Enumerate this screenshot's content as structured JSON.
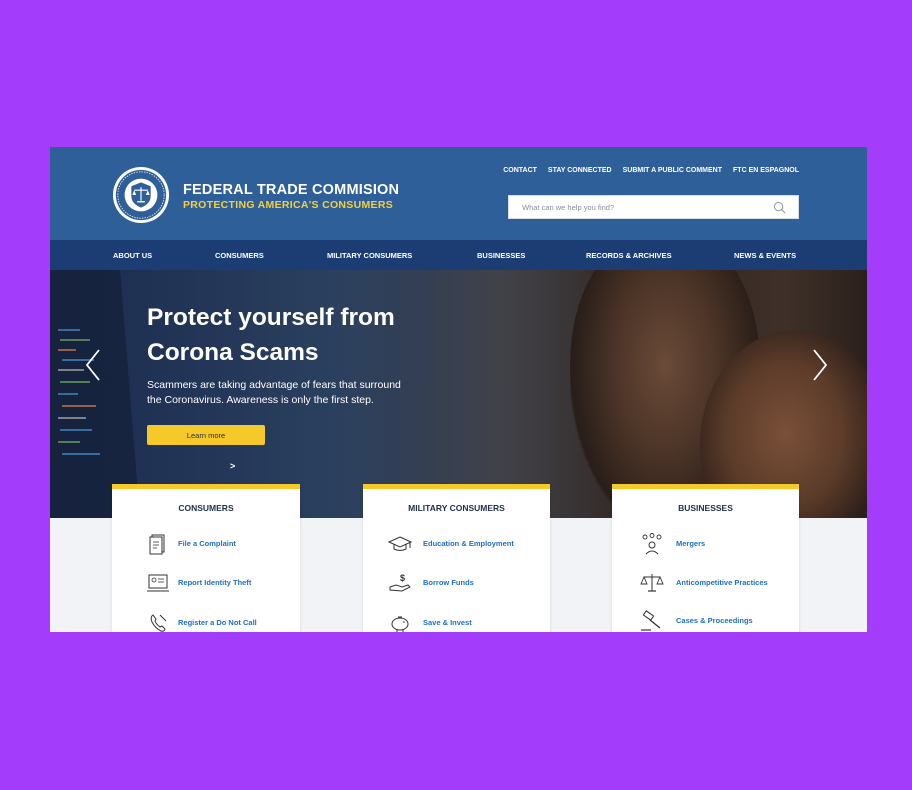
{
  "brand": {
    "title": "FEDERAL TRADE COMMISION",
    "subtitle": "PROTECTING AMERICA'S CONSUMERS",
    "seal_icon": "ftc-seal-icon"
  },
  "utility_nav": [
    "CONTACT",
    "STAY CONNECTED",
    "SUBMIT A PUBLIC COMMENT",
    "FTC EN ESPAGNOL"
  ],
  "search": {
    "placeholder": "What can we help you find?",
    "value": ""
  },
  "main_nav": [
    "ABOUT US",
    "CONSUMERS",
    "MILITARY CONSUMERS",
    "BUSINESSES",
    "RECORDS & ARCHIVES",
    "NEWS & EVENTS"
  ],
  "hero": {
    "title_line1": "Protect yourself from",
    "title_line2": "Corona Scams",
    "description_line1": "Scammers are taking advantage of fears that surround",
    "description_line2": "the Coronavirus. Awareness is only the first step.",
    "button_label": "Learn more",
    "pager_glyph": ">"
  },
  "cards": [
    {
      "title": "CONSUMERS",
      "items": [
        {
          "label": "File a Complaint",
          "icon": "document-icon"
        },
        {
          "label": "Report Identity Theft",
          "icon": "id-card-icon"
        },
        {
          "label": "Register a Do Not Call",
          "icon": "phone-icon"
        }
      ]
    },
    {
      "title": "MILITARY CONSUMERS",
      "items": [
        {
          "label": "Education & Employment",
          "icon": "graduation-cap-icon"
        },
        {
          "label": "Borrow Funds",
          "icon": "money-hand-icon"
        },
        {
          "label": "Save & Invest",
          "icon": "piggy-bank-icon"
        }
      ]
    },
    {
      "title": "BUSINESSES",
      "items": [
        {
          "label": "Mergers",
          "icon": "people-network-icon"
        },
        {
          "label": "Anticompetitive Practices",
          "icon": "scales-icon"
        },
        {
          "label": "Cases & Proceedings",
          "icon": "gavel-icon"
        }
      ]
    }
  ],
  "colors": {
    "page_background": "#a43cfb",
    "header": "#2f5f99",
    "nav": "#1c3d73",
    "accent_yellow": "#f6c92a",
    "link_blue": "#1f6fc4"
  }
}
